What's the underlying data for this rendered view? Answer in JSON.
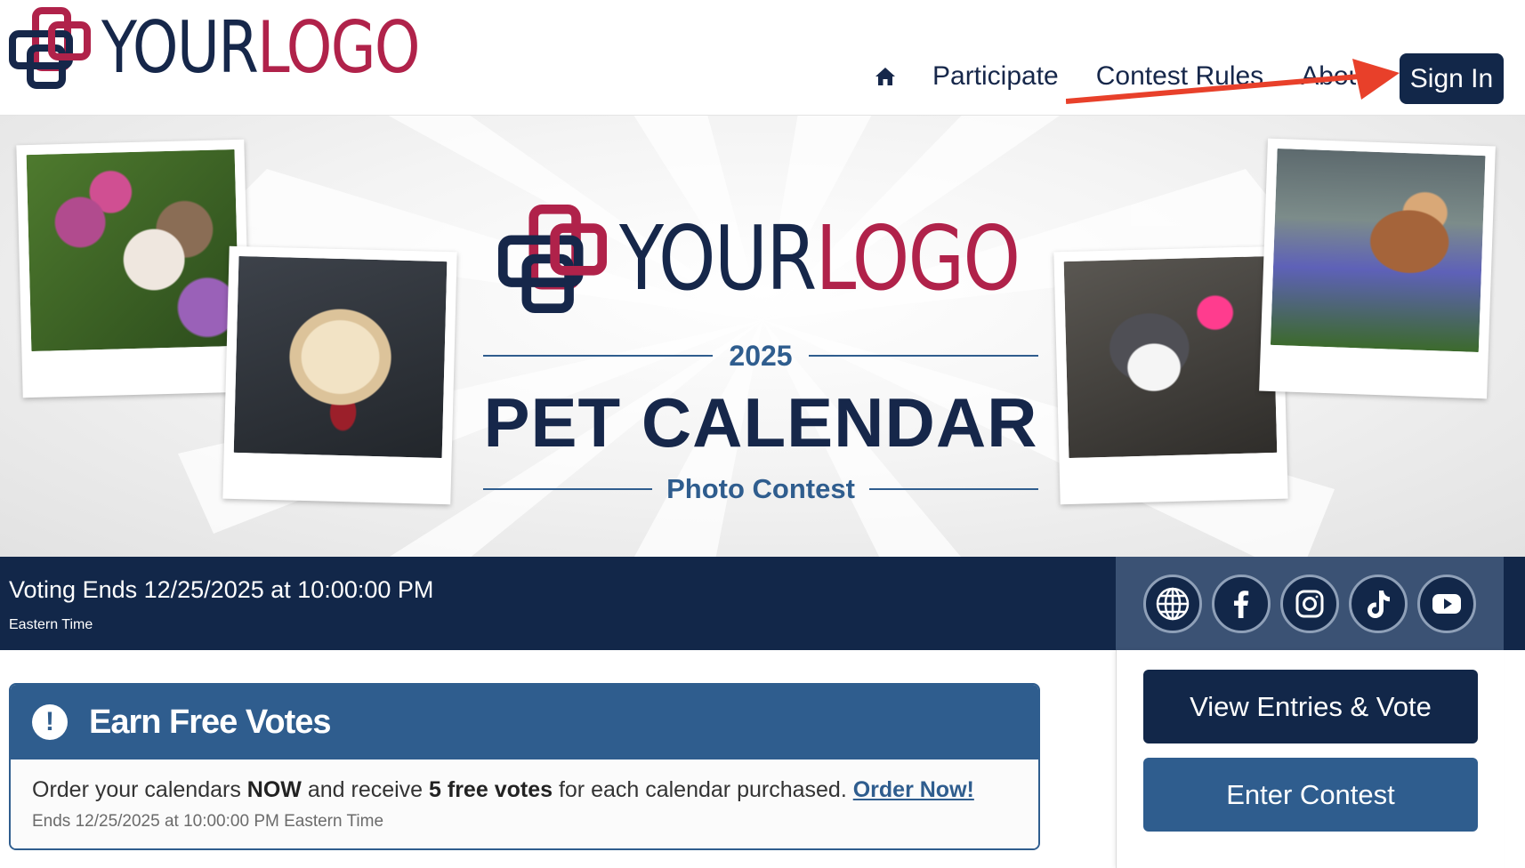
{
  "header": {
    "logo": {
      "part1": "YOUR",
      "part2": "LOGO"
    },
    "nav": {
      "participate": "Participate",
      "contest_rules": "Contest Rules",
      "about": "About"
    },
    "sign_in": "Sign In"
  },
  "hero": {
    "logo": {
      "part1": "YOUR",
      "part2": "LOGO"
    },
    "year": "2025",
    "title": "PET CALENDAR",
    "subtitle": "Photo Contest"
  },
  "voting": {
    "text": "Voting Ends 12/25/2025 at 10:00:00 PM",
    "timezone": "Eastern Time"
  },
  "social": [
    "website-icon",
    "facebook-icon",
    "instagram-icon",
    "tiktok-icon",
    "youtube-icon"
  ],
  "sidebar": {
    "view_entries": "View Entries & Vote",
    "enter_contest": "Enter Contest"
  },
  "earn_votes": {
    "title": "Earn Free Votes",
    "msg_part1": "Order your calendars ",
    "msg_bold1": "NOW",
    "msg_part2": " and receive ",
    "msg_bold2": "5 free votes",
    "msg_part3": " for each calendar purchased. ",
    "link": "Order Now!",
    "ends": "Ends 12/25/2025 at 10:00:00 PM Eastern Time"
  },
  "colors": {
    "navy": "#122749",
    "blue": "#2f5d8e",
    "crimson": "#b0224a",
    "arrow": "#e8402a"
  }
}
